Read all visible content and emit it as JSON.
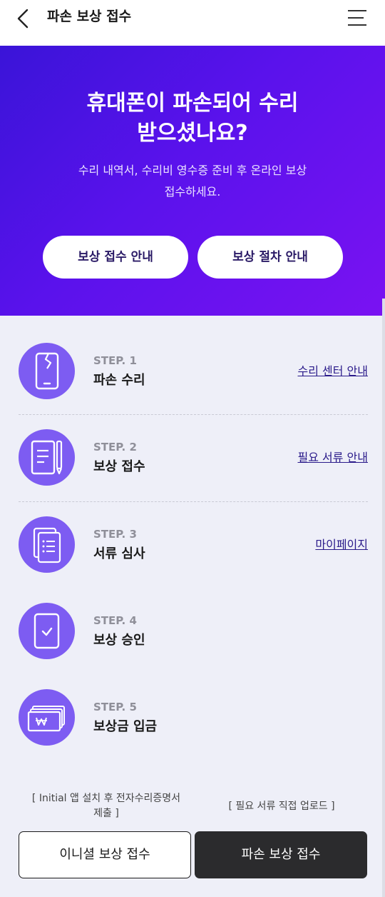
{
  "header": {
    "title": "파손 보상 접수",
    "back_icon": "chevron-left-icon",
    "menu_icon": "hamburger-menu-icon"
  },
  "hero": {
    "title": "휴대폰이 파손되어 수리\n받으셨나요?",
    "description": "수리 내역서, 수리비 영수증 준비 후 온라인 보상\n접수하세요.",
    "buttons": [
      "보상 접수 안내",
      "보상 절차 안내"
    ],
    "gradient_colors": [
      "#3a14d8",
      "#7a12f2"
    ]
  },
  "steps": [
    {
      "number": "STEP. 1",
      "name": "파손 수리",
      "link": "수리 센터 안내",
      "icon": "broken-phone-icon"
    },
    {
      "number": "STEP. 2",
      "name": "보상 접수",
      "link": "필요 서류 안내",
      "icon": "document-pen-icon"
    },
    {
      "number": "STEP. 3",
      "name": "서류 심사",
      "link": "마이페이지",
      "icon": "documents-review-icon"
    },
    {
      "number": "STEP. 4",
      "name": "보상 승인",
      "link": "",
      "icon": "tablet-check-icon"
    },
    {
      "number": "STEP. 5",
      "name": "보상금 입금",
      "link": "",
      "icon": "won-cash-icon"
    }
  ],
  "footer": {
    "note_left": "[ Initial 앱 설치 후 전자수리증명서\n제출 ]",
    "note_right": "[ 필요 서류 직접 업로드 ]",
    "button_left": "이니셜 보상 접수",
    "button_right": "파손 보상 접수"
  },
  "colors": {
    "step_circle": "#7d5cf2",
    "link": "#2a1a8a",
    "primary_button": "#2b2b2d"
  }
}
